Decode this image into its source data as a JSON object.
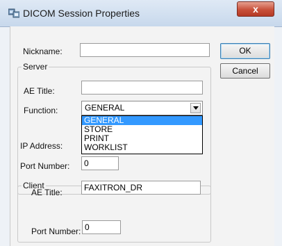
{
  "window": {
    "title": "DICOM Session Properties",
    "close_label": "x"
  },
  "form": {
    "nickname_label": "Nickname:",
    "nickname_value": "",
    "ok_label": "OK",
    "cancel_label": "Cancel"
  },
  "server": {
    "group_label": "Server",
    "ae_title_label": "AE Title:",
    "ae_title_value": "",
    "function_label": "Function:",
    "function_selected": "GENERAL",
    "function_options": [
      "GENERAL",
      "STORE",
      "PRINT",
      "WORKLIST"
    ],
    "ip_address_label": "IP Address:",
    "port_label": "Port Number:",
    "port_value": "0"
  },
  "client": {
    "group_label": "Client",
    "ae_title_label": "AE Title:",
    "ae_title_value": "FAXITRON_DR",
    "port_label": "Port Number:",
    "port_value": "0"
  },
  "icons": {
    "app": "dicom-session-icon",
    "close": "close-icon",
    "dropdown": "chevron-down-icon"
  }
}
